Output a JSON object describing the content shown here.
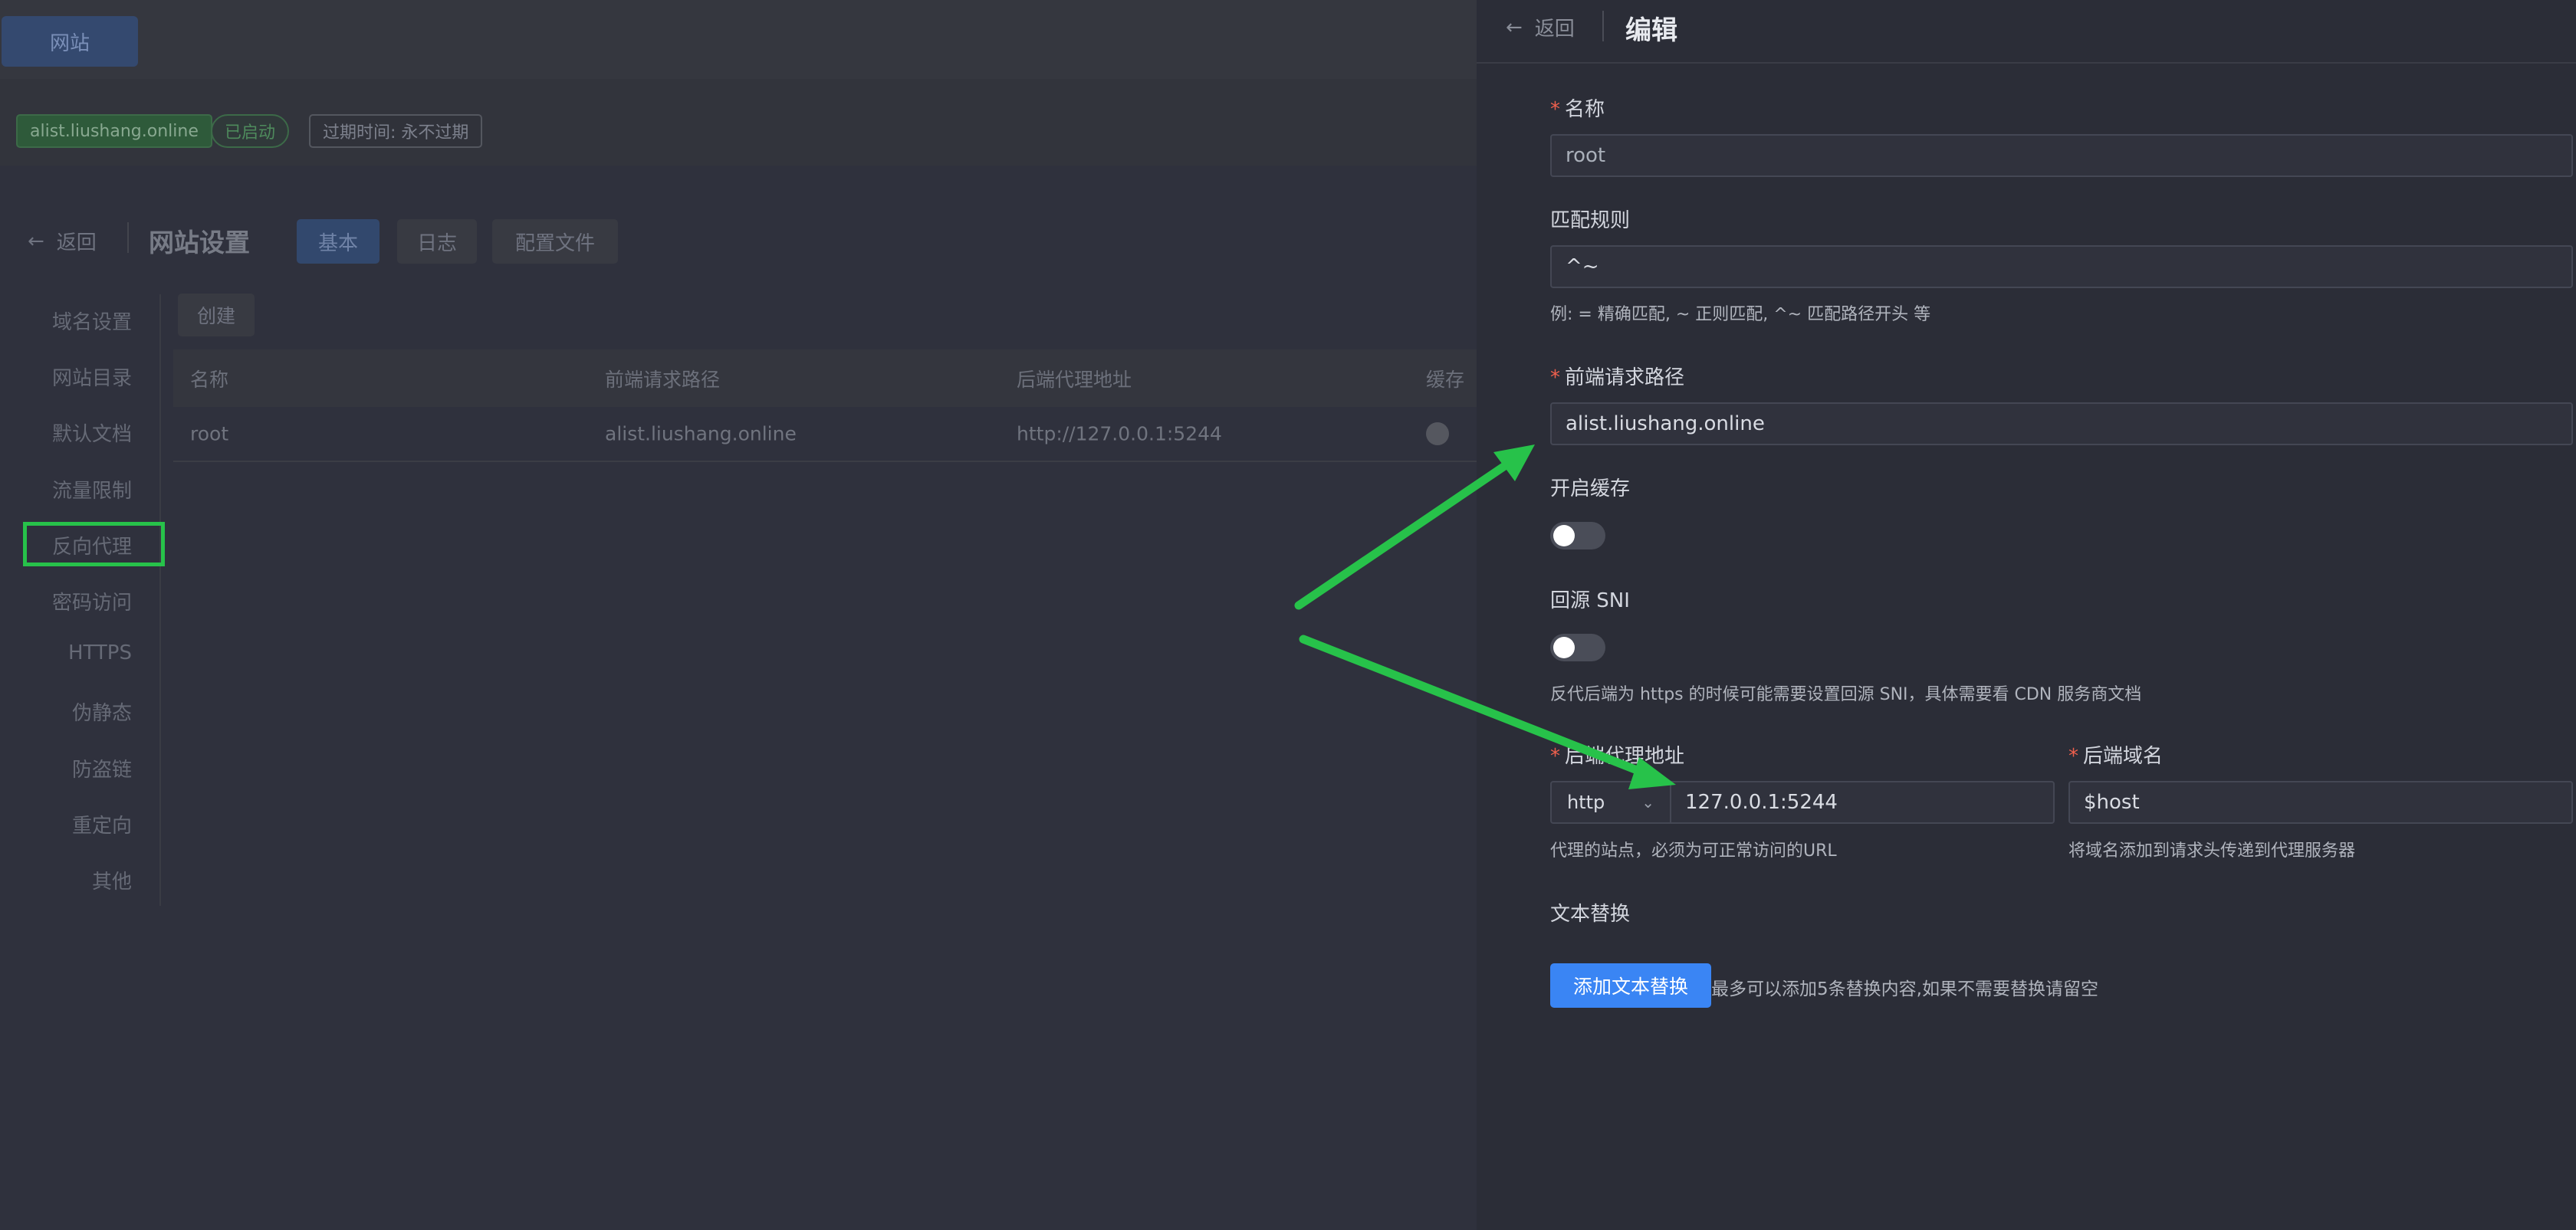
{
  "background": {
    "site_button": "网站",
    "tags": {
      "domain": "alist.liushang.online",
      "status": "已启动",
      "expire": "过期时间: 永不过期"
    },
    "back": "返回",
    "title": "网站设置",
    "tabs": [
      "基本",
      "日志",
      "配置文件"
    ],
    "nav": [
      "域名设置",
      "网站目录",
      "默认文档",
      "流量限制",
      "反向代理",
      "密码访问",
      "HTTPS",
      "伪静态",
      "防盗链",
      "重定向",
      "其他"
    ],
    "create": "创建",
    "table": {
      "headers": [
        "名称",
        "前端请求路径",
        "后端代理地址",
        "缓存"
      ],
      "rows": [
        {
          "name": "root",
          "path": "alist.liushang.online",
          "proxy": "http://127.0.0.1:5244"
        }
      ]
    }
  },
  "drawer": {
    "back": "返回",
    "title": "编辑",
    "name_label": "名称",
    "name_value": "root",
    "match_label": "匹配规则",
    "match_value": "^~",
    "match_hint": "例: = 精确匹配, ~ 正则匹配, ^~ 匹配路径开头 等",
    "frontend_label": "前端请求路径",
    "frontend_value": "alist.liushang.online",
    "cache_label": "开启缓存",
    "cache_enabled": false,
    "sni_label": "回源 SNI",
    "sni_enabled": false,
    "sni_hint": "反代后端为 https 的时候可能需要设置回源 SNI，具体需要看 CDN 服务商文档",
    "proxy_label": "后端代理地址",
    "protocol": "http",
    "proxy_value": "127.0.0.1:5244",
    "proxy_hint": "代理的站点，必须为可正常访问的URL",
    "host_label": "后端域名",
    "host_value": "$host",
    "host_hint": "将域名添加到请求头传递到代理服务器",
    "replace_label": "文本替换",
    "add_replace": "添加文本替换",
    "replace_hint": "最多可以添加5条替换内容,如果不需要替换请留空"
  },
  "colors": {
    "accent": "#3a85f4",
    "annotation": "#27c24a",
    "required": "#f0604d"
  }
}
